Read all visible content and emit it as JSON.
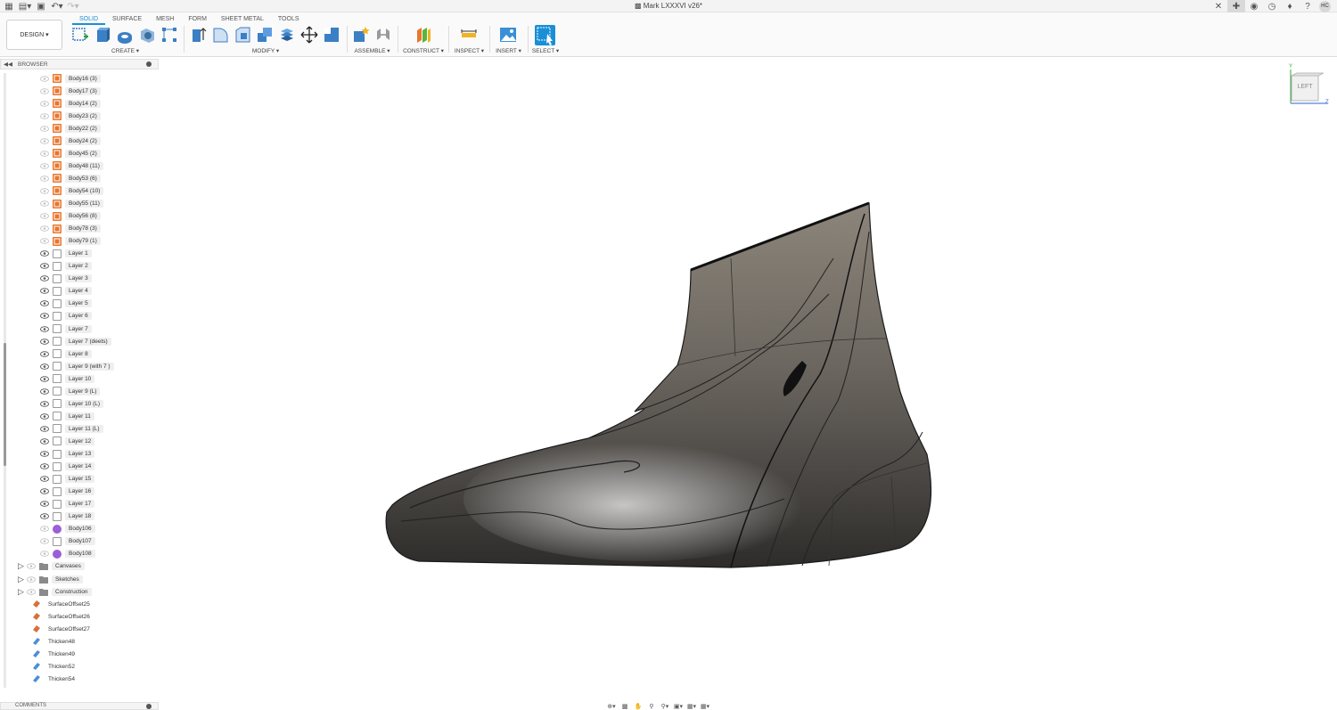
{
  "window": {
    "title": "Mark LXXXVI v26*",
    "user_initials": "HC"
  },
  "toolbar": {
    "tabs": [
      "SOLID",
      "SURFACE",
      "MESH",
      "FORM",
      "SHEET METAL",
      "TOOLS"
    ],
    "active_tab": "SOLID",
    "workspace_button": "DESIGN",
    "groups": {
      "create": "CREATE",
      "modify": "MODIFY",
      "assemble": "ASSEMBLE",
      "construct": "CONSTRUCT",
      "inspect": "INSPECT",
      "insert": "INSERT",
      "select": "SELECT"
    }
  },
  "browser": {
    "title": "BROWSER",
    "items": [
      {
        "label": "Body16 (3)",
        "type": "body",
        "visible": false
      },
      {
        "label": "Body17 (3)",
        "type": "body",
        "visible": false
      },
      {
        "label": "Body14 (2)",
        "type": "body",
        "visible": false
      },
      {
        "label": "Body23 (2)",
        "type": "body",
        "visible": false
      },
      {
        "label": "Body22 (2)",
        "type": "body",
        "visible": false
      },
      {
        "label": "Body24 (2)",
        "type": "body",
        "visible": false
      },
      {
        "label": "Body45 (2)",
        "type": "body",
        "visible": false
      },
      {
        "label": "Body48 (11)",
        "type": "body",
        "visible": false
      },
      {
        "label": "Body53 (6)",
        "type": "body",
        "visible": false
      },
      {
        "label": "Body54 (10)",
        "type": "body",
        "visible": false
      },
      {
        "label": "Body55 (11)",
        "type": "body",
        "visible": false
      },
      {
        "label": "Body56 (8)",
        "type": "body",
        "visible": false
      },
      {
        "label": "Body78 (3)",
        "type": "body",
        "visible": false
      },
      {
        "label": "Body79 (1)",
        "type": "body",
        "visible": false
      },
      {
        "label": "Layer 1",
        "type": "layer",
        "visible": true
      },
      {
        "label": "Layer 2",
        "type": "layer",
        "visible": true
      },
      {
        "label": "Layer 3",
        "type": "layer",
        "visible": true
      },
      {
        "label": "Layer 4",
        "type": "layer",
        "visible": true
      },
      {
        "label": "Layer 5",
        "type": "layer",
        "visible": true
      },
      {
        "label": "Layer 6",
        "type": "layer",
        "visible": true
      },
      {
        "label": "Layer 7",
        "type": "layer",
        "visible": true
      },
      {
        "label": "Layer 7 (deets)",
        "type": "layer",
        "visible": true
      },
      {
        "label": "Layer 8",
        "type": "layer",
        "visible": true
      },
      {
        "label": "Layer 9 (with 7 )",
        "type": "layer",
        "visible": true
      },
      {
        "label": "Layer 10",
        "type": "layer",
        "visible": true
      },
      {
        "label": "Layer 9 (L)",
        "type": "layer",
        "visible": true
      },
      {
        "label": "Layer 10 (L)",
        "type": "layer",
        "visible": true
      },
      {
        "label": "Layer 11",
        "type": "layer",
        "visible": true
      },
      {
        "label": "Layer 11 (L)",
        "type": "layer",
        "visible": true
      },
      {
        "label": "Layer 12",
        "type": "layer",
        "visible": true
      },
      {
        "label": "Layer 13",
        "type": "layer",
        "visible": true
      },
      {
        "label": "Layer 14",
        "type": "layer",
        "visible": true
      },
      {
        "label": "Layer 15",
        "type": "layer",
        "visible": true
      },
      {
        "label": "Layer 16",
        "type": "layer",
        "visible": true
      },
      {
        "label": "Layer 17",
        "type": "layer",
        "visible": true
      },
      {
        "label": "Layer 18",
        "type": "layer",
        "visible": true
      },
      {
        "label": "Body106",
        "type": "tsbody",
        "visible": false
      },
      {
        "label": "Body107",
        "type": "layer",
        "visible": false
      },
      {
        "label": "Body108",
        "type": "tsbody",
        "visible": false
      },
      {
        "label": "Canvases",
        "type": "folder",
        "visible": false
      },
      {
        "label": "Sketches",
        "type": "folder",
        "visible": false
      },
      {
        "label": "Construction",
        "type": "folder",
        "visible": false
      },
      {
        "label": "SurfaceOffset25",
        "type": "surface"
      },
      {
        "label": "SurfaceOffset26",
        "type": "surface"
      },
      {
        "label": "SurfaceOffset27",
        "type": "surface"
      },
      {
        "label": "Thicken48",
        "type": "thicken"
      },
      {
        "label": "Thicken49",
        "type": "thicken"
      },
      {
        "label": "Thicken52",
        "type": "thicken"
      },
      {
        "label": "Thicken54",
        "type": "thicken"
      }
    ]
  },
  "comments": {
    "title": "COMMENTS"
  },
  "viewcube": {
    "face": "LEFT",
    "axis_y": "Y",
    "axis_z": "Z"
  },
  "colors": {
    "accent": "#1a8fd6",
    "body_orange": "#e8762d",
    "tsbody_purple": "#9b5fd6",
    "surface_orange": "#d9703a",
    "thicken_blue": "#4a8ed9"
  }
}
